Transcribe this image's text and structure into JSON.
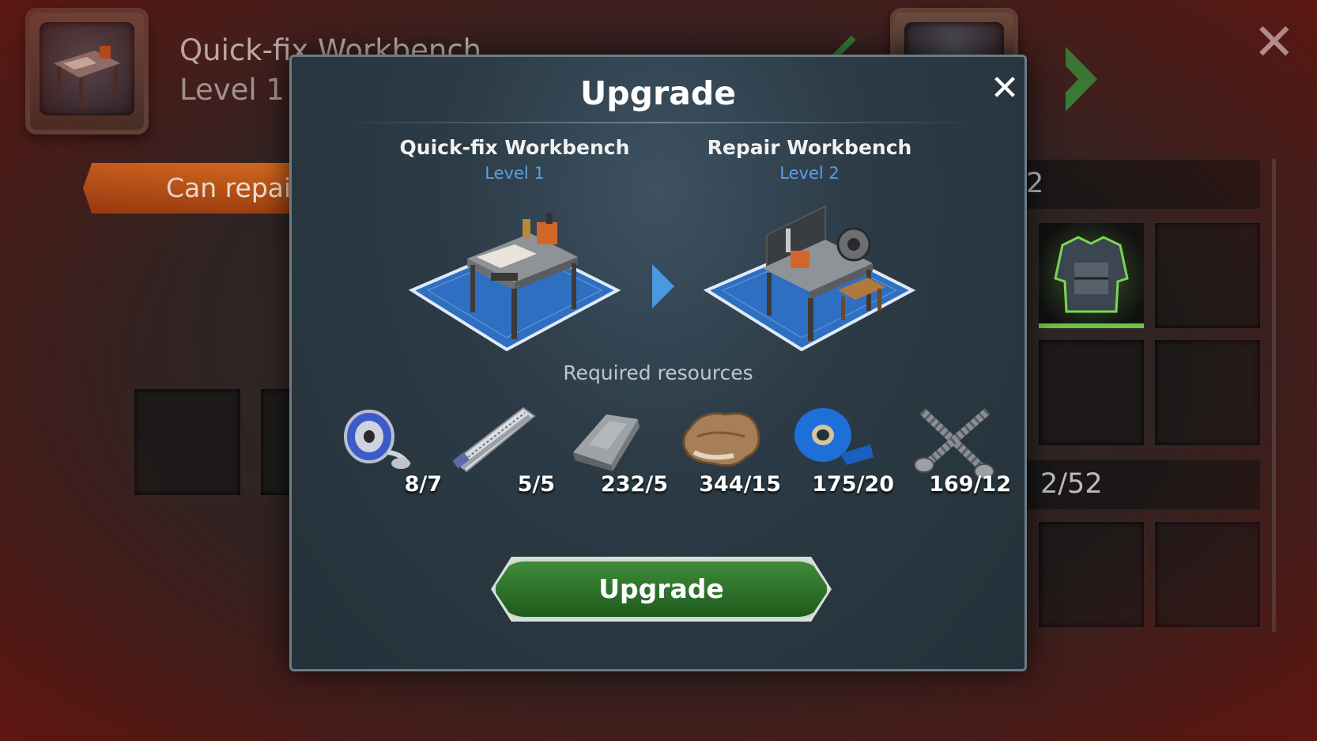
{
  "background": {
    "title": "Quick-fix Workbench",
    "level": "Level 1",
    "can_repair_label": "Can repair",
    "bar1_text": "2",
    "bar2_text": "2/52"
  },
  "modal": {
    "title": "Upgrade",
    "current": {
      "name": "Quick-fix Workbench",
      "level": "Level 1"
    },
    "next": {
      "name": "Repair Workbench",
      "level": "Level 2"
    },
    "required_label": "Required resources",
    "resources": [
      {
        "icon": "solder-spool-icon",
        "count": "8/7"
      },
      {
        "icon": "saw-blade-icon",
        "count": "5/5"
      },
      {
        "icon": "metal-ingot-icon",
        "count": "232/5"
      },
      {
        "icon": "leather-icon",
        "count": "344/15"
      },
      {
        "icon": "tape-roll-icon",
        "count": "175/20"
      },
      {
        "icon": "screws-icon",
        "count": "169/12"
      }
    ],
    "button_label": "Upgrade"
  },
  "colors": {
    "accent_blue": "#4a98e0",
    "button_green": "#2f7a2c",
    "orange_tab": "#c2571a"
  }
}
